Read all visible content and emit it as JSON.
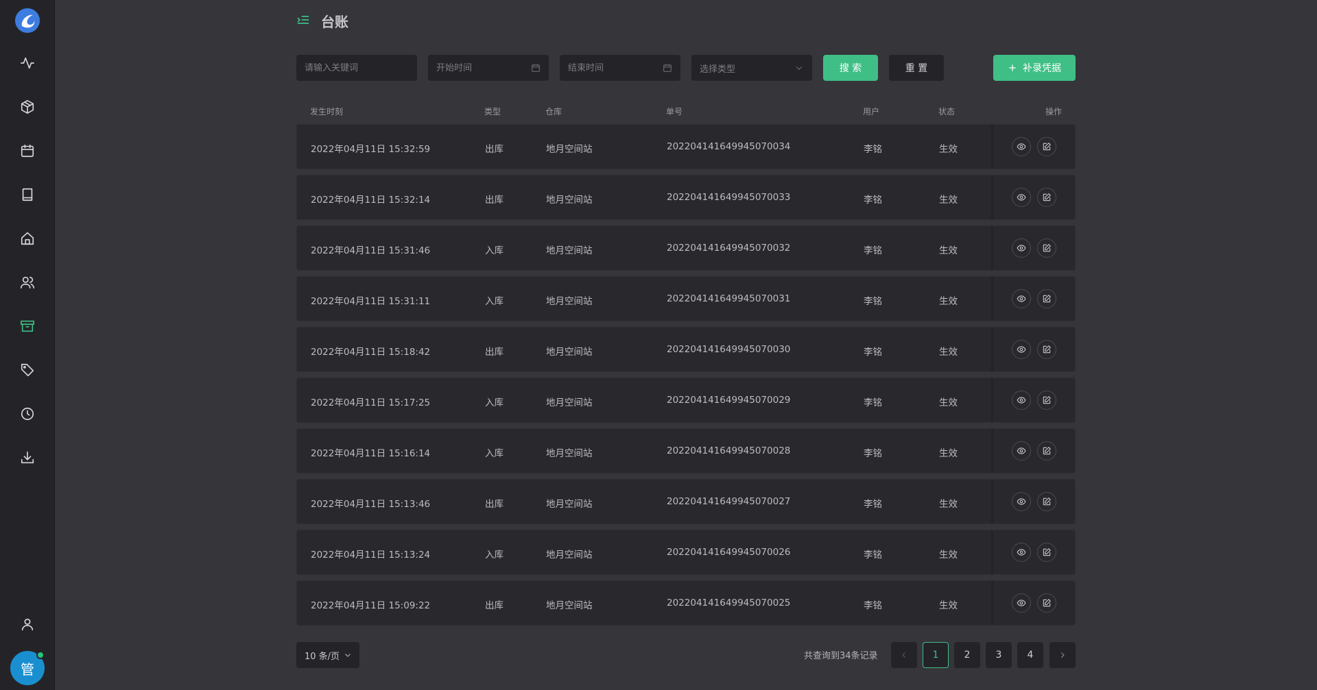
{
  "page": {
    "title": "台账"
  },
  "sidebar": {
    "items": [
      {
        "icon": "activity-icon"
      },
      {
        "icon": "package-icon"
      },
      {
        "icon": "calendar-icon"
      },
      {
        "icon": "book-icon"
      },
      {
        "icon": "home-icon"
      },
      {
        "icon": "users-icon"
      },
      {
        "icon": "archive-icon",
        "active": true
      },
      {
        "icon": "tag-icon"
      },
      {
        "icon": "clock-icon"
      },
      {
        "icon": "download-icon"
      }
    ],
    "user_icon": "user-icon",
    "avatar_text": "管"
  },
  "toolbar": {
    "keyword_placeholder": "请输入关键词",
    "start_placeholder": "开始时间",
    "end_placeholder": "结束时间",
    "type_placeholder": "选择类型",
    "search_label": "搜 索",
    "reset_label": "重 置",
    "add_label": "补录凭据"
  },
  "table": {
    "columns": [
      "发生时刻",
      "类型",
      "仓库",
      "单号",
      "用户",
      "状态",
      "操作"
    ],
    "rows": [
      {
        "time": "2022年04月11日 15:32:59",
        "type": "出库",
        "warehouse": "地月空间站",
        "number": "202204141649945070034",
        "user": "李铭",
        "status": "生效"
      },
      {
        "time": "2022年04月11日 15:32:14",
        "type": "出库",
        "warehouse": "地月空间站",
        "number": "202204141649945070033",
        "user": "李铭",
        "status": "生效"
      },
      {
        "time": "2022年04月11日 15:31:46",
        "type": "入库",
        "warehouse": "地月空间站",
        "number": "202204141649945070032",
        "user": "李铭",
        "status": "生效"
      },
      {
        "time": "2022年04月11日 15:31:11",
        "type": "入库",
        "warehouse": "地月空间站",
        "number": "202204141649945070031",
        "user": "李铭",
        "status": "生效"
      },
      {
        "time": "2022年04月11日 15:18:42",
        "type": "出库",
        "warehouse": "地月空间站",
        "number": "202204141649945070030",
        "user": "李铭",
        "status": "生效"
      },
      {
        "time": "2022年04月11日 15:17:25",
        "type": "入库",
        "warehouse": "地月空间站",
        "number": "202204141649945070029",
        "user": "李铭",
        "status": "生效"
      },
      {
        "time": "2022年04月11日 15:16:14",
        "type": "入库",
        "warehouse": "地月空间站",
        "number": "202204141649945070028",
        "user": "李铭",
        "status": "生效"
      },
      {
        "time": "2022年04月11日 15:13:46",
        "type": "出库",
        "warehouse": "地月空间站",
        "number": "202204141649945070027",
        "user": "李铭",
        "status": "生效"
      },
      {
        "time": "2022年04月11日 15:13:24",
        "type": "入库",
        "warehouse": "地月空间站",
        "number": "202204141649945070026",
        "user": "李铭",
        "status": "生效"
      },
      {
        "time": "2022年04月11日 15:09:22",
        "type": "出库",
        "warehouse": "地月空间站",
        "number": "202204141649945070025",
        "user": "李铭",
        "status": "生效"
      }
    ]
  },
  "pagination": {
    "page_size_label": "10 条/页",
    "total_text": "共查询到34条记录",
    "pages": [
      "1",
      "2",
      "3",
      "4"
    ],
    "current": "1"
  },
  "colors": {
    "accent": "#3fbf86",
    "background": "#35353a",
    "sidebar": "#242428",
    "row": "#29292d",
    "avatar": "#1a8fd0"
  }
}
